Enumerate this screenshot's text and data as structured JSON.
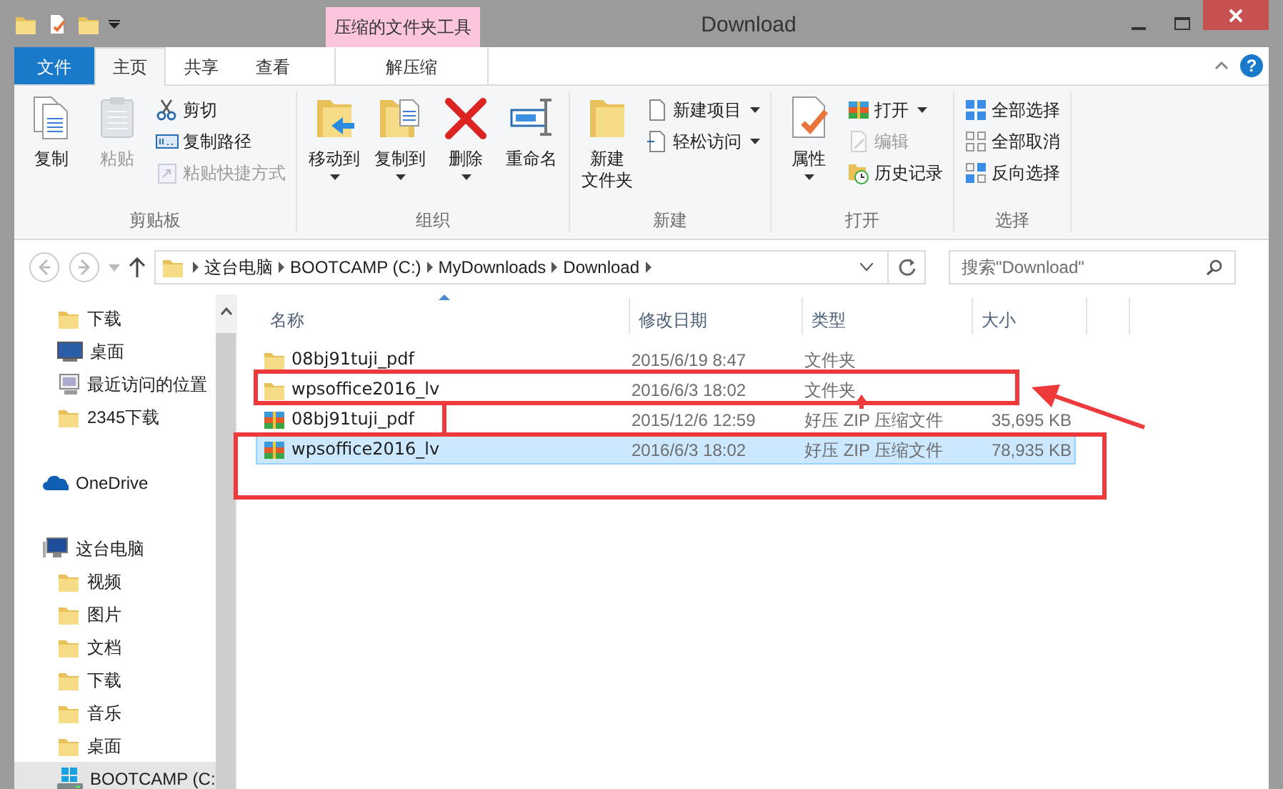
{
  "title_bar": {
    "title": "Download",
    "contextual_label": "压缩的文件夹工具"
  },
  "help": "?",
  "tabs": [
    {
      "label": "文件",
      "kind": "file",
      "selected": false
    },
    {
      "label": "主页",
      "kind": "normal",
      "selected": true
    },
    {
      "label": "共享",
      "kind": "normal",
      "selected": false
    },
    {
      "label": "查看",
      "kind": "normal",
      "selected": false
    },
    {
      "label": "解压缩",
      "kind": "contextual",
      "selected": false
    }
  ],
  "ribbon": [
    {
      "label": "剪贴板",
      "items": [
        {
          "label": "复制",
          "kind": "large",
          "disabled": false,
          "dropdown": false
        },
        {
          "label": "粘贴",
          "kind": "large",
          "disabled": true,
          "dropdown": false
        },
        {
          "label": "剪切",
          "kind": "small",
          "disabled": false,
          "dropdown": false
        },
        {
          "label": "复制路径",
          "kind": "small",
          "disabled": false,
          "dropdown": false
        },
        {
          "label": "粘贴快捷方式",
          "kind": "small",
          "disabled": true,
          "dropdown": false
        }
      ]
    },
    {
      "label": "组织",
      "items": [
        {
          "label": "移动到",
          "kind": "large",
          "disabled": false,
          "dropdown": true
        },
        {
          "label": "复制到",
          "kind": "large",
          "disabled": false,
          "dropdown": true
        },
        {
          "label": "删除",
          "kind": "large",
          "disabled": false,
          "dropdown": true
        },
        {
          "label": "重命名",
          "kind": "large",
          "disabled": false,
          "dropdown": false
        }
      ]
    },
    {
      "label": "新建",
      "items": [
        {
          "label": [
            "新建",
            "文件夹"
          ],
          "kind": "large",
          "disabled": false,
          "dropdown": false
        },
        {
          "label": "新建项目",
          "kind": "small",
          "disabled": false,
          "dropdown": true
        },
        {
          "label": "轻松访问",
          "kind": "small",
          "disabled": false,
          "dropdown": true
        }
      ]
    },
    {
      "label": "打开",
      "items": [
        {
          "label": "属性",
          "kind": "large",
          "disabled": false,
          "dropdown": true
        },
        {
          "label": "打开",
          "kind": "small",
          "disabled": false,
          "dropdown": true
        },
        {
          "label": "编辑",
          "kind": "small",
          "disabled": true,
          "dropdown": false
        },
        {
          "label": "历史记录",
          "kind": "small",
          "disabled": false,
          "dropdown": false
        }
      ]
    },
    {
      "label": "选择",
      "items": [
        {
          "label": "全部选择",
          "kind": "small",
          "disabled": false,
          "dropdown": false
        },
        {
          "label": "全部取消",
          "kind": "small",
          "disabled": false,
          "dropdown": false
        },
        {
          "label": "反向选择",
          "kind": "small",
          "disabled": false,
          "dropdown": false
        }
      ]
    }
  ],
  "address_bar": {
    "segments": [
      "这台电脑",
      "BOOTCAMP (C:)",
      "MyDownloads",
      "Download"
    ],
    "search_placeholder": "搜索\"Download\""
  },
  "navigation": [
    {
      "items": [
        {
          "label": "下载",
          "kind": "folder",
          "highlighted": false
        },
        {
          "label": "桌面",
          "kind": "desktop",
          "highlighted": false
        },
        {
          "label": "最近访问的位置",
          "kind": "recent",
          "highlighted": false
        },
        {
          "label": "2345下载",
          "kind": "folder",
          "highlighted": false
        }
      ]
    },
    {
      "items": [
        {
          "label": "OneDrive",
          "kind": "cloud",
          "highlighted": false
        }
      ]
    },
    {
      "items": [
        {
          "label": "这台电脑",
          "kind": "computer",
          "highlighted": false,
          "children": [
            {
              "label": "视频",
              "kind": "folder",
              "highlighted": false
            },
            {
              "label": "图片",
              "kind": "folder",
              "highlighted": false
            },
            {
              "label": "文档",
              "kind": "folder",
              "highlighted": false
            },
            {
              "label": "下载",
              "kind": "folder",
              "highlighted": false
            },
            {
              "label": "音乐",
              "kind": "folder",
              "highlighted": false
            },
            {
              "label": "桌面",
              "kind": "folder",
              "highlighted": false
            },
            {
              "label": "BOOTCAMP (C:",
              "kind": "drive",
              "highlighted": true
            }
          ]
        }
      ]
    }
  ],
  "file_list": {
    "columns": [
      "名称",
      "修改日期",
      "类型",
      "大小"
    ],
    "rows": [
      {
        "name": "08bj91tuji_pdf",
        "date": "2015/6/19 8:47",
        "type": "文件夹",
        "kind": "folder",
        "selected": false
      },
      {
        "name": "wpsoffice2016_lv",
        "date": "2016/6/3 18:02",
        "type": "文件夹",
        "kind": "folder",
        "selected": false
      },
      {
        "name": "08bj91tuji_pdf",
        "date": "2015/12/6 12:59",
        "type": "好压 ZIP 压缩文件",
        "size": "35,695 KB",
        "kind": "archive",
        "selected": false
      },
      {
        "name": "wpsoffice2016_lv",
        "date": "2016/6/3 18:02",
        "type": "好压 ZIP 压缩文件",
        "size": "78,935 KB",
        "kind": "archive",
        "selected": true
      }
    ]
  }
}
